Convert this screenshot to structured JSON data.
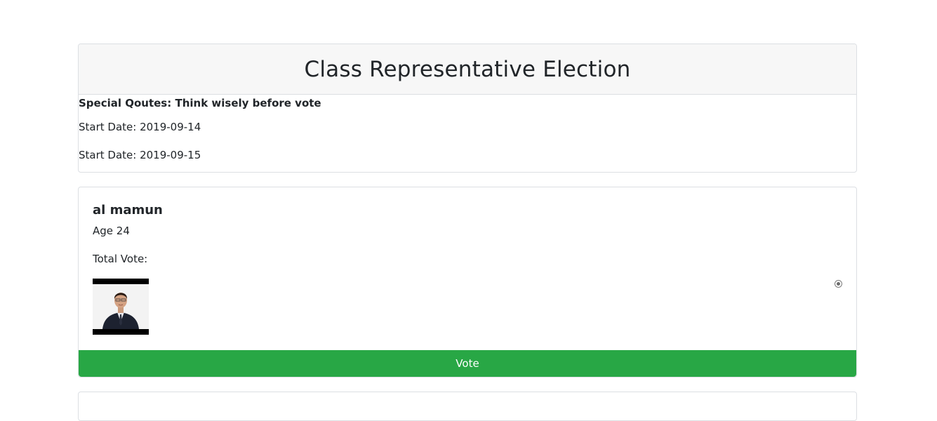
{
  "election": {
    "title": "Class Representative Election",
    "quote": "Special Qoutes: Think wisely before vote",
    "start_date": "Start Date: 2019-09-14",
    "end_date": "Start Date: 2019-09-15"
  },
  "candidates": [
    {
      "name": "al mamun",
      "age": "Age 24",
      "total_vote": "Total Vote:",
      "selected": true,
      "vote_label": "Vote"
    }
  ],
  "colors": {
    "vote_button": "#28a745",
    "header_bg": "#f7f7f7",
    "border": "#dcdfe3"
  }
}
